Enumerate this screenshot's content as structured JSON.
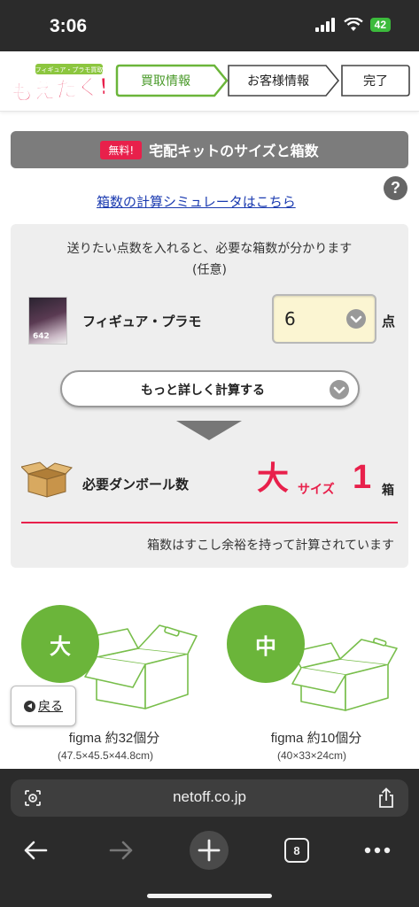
{
  "status_bar": {
    "time": "3:06",
    "battery": "42"
  },
  "header": {
    "logo_text": "もえたく!",
    "logo_tagline": "フィギュア・プラモ買取",
    "steps": [
      {
        "label": "買取情報",
        "active": true
      },
      {
        "label": "お客様情報",
        "active": false
      },
      {
        "label": "完了",
        "active": false
      }
    ]
  },
  "title_bar": {
    "badge": "無料!",
    "title": "宅配キットのサイズと箱数"
  },
  "simulator_link": "箱数の計算シミュレータはこちら",
  "help_icon": "?",
  "calculator": {
    "description_line1": "送りたい点数を入れると、必要な箱数が分かります",
    "description_line2": "(任意)",
    "item_thumb_text": "642",
    "item_label": "フィギュア・プラモ",
    "quantity": "6",
    "unit": "点",
    "detail_button": "もっと詳しく計算する",
    "result_label": "必要ダンボール数",
    "result_size": "大",
    "result_size_suffix": "サイズ",
    "result_count": "1",
    "result_unit": "箱",
    "note": "箱数はすこし余裕を持って計算されています"
  },
  "box_cards": [
    {
      "size": "大",
      "title": "figma 約32個分",
      "dims": "(47.5×45.5×44.8cm)"
    },
    {
      "size": "中",
      "title": "figma 約10個分",
      "dims": "(40×33×24cm)"
    }
  ],
  "back_button": "戻る",
  "browser": {
    "url": "netoff.co.jp",
    "tab_count": "8"
  },
  "colors": {
    "accent_green": "#6bb53a",
    "accent_pink": "#e8204b",
    "panel_gray": "#eeeeee",
    "link_blue": "#1a3ab0"
  },
  "icons": [
    "signal-icon",
    "wifi-icon",
    "help-icon",
    "chevron-down-icon",
    "cardboard-box-icon",
    "back-arrow-icon",
    "site-settings-icon",
    "share-icon",
    "nav-back-icon",
    "nav-forward-icon",
    "new-tab-icon",
    "tabs-icon",
    "more-icon"
  ]
}
